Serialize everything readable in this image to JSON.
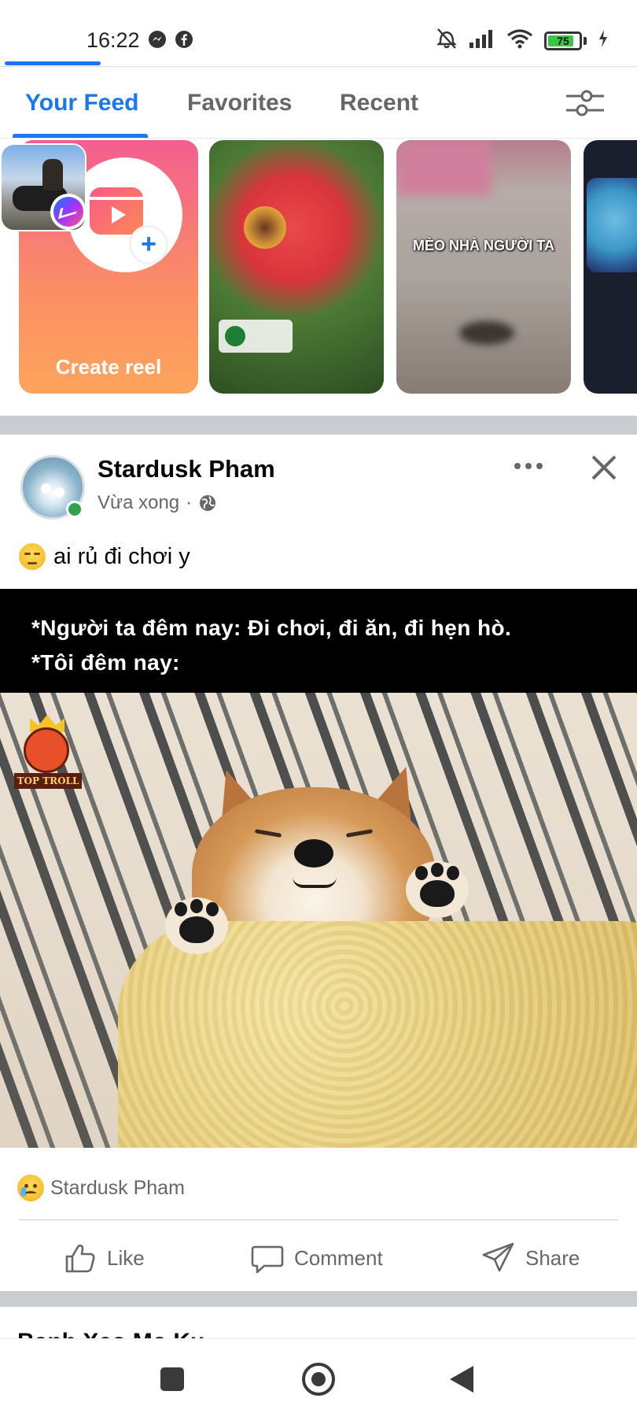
{
  "status_bar": {
    "time": "16:22",
    "left_icons": [
      "messenger-icon",
      "facebook-icon"
    ],
    "right_icons": [
      "mute-icon",
      "signal-icon",
      "wifi-icon",
      "battery-icon",
      "charging-icon"
    ],
    "battery_level": "75"
  },
  "tabs": [
    {
      "label": "Your Feed",
      "active": true
    },
    {
      "label": "Favorites",
      "active": false
    },
    {
      "label": "Recent",
      "active": false
    }
  ],
  "filter_icon": "filter-sliders-icon",
  "reels": {
    "create_label": "Create reel",
    "items": [
      {
        "caption": ""
      },
      {
        "caption": "MÈO NHÀ NGƯỜI TA"
      },
      {
        "caption": ""
      }
    ]
  },
  "post": {
    "author": "Stardusk Pham",
    "time": "Vừa xong",
    "separator": "·",
    "audience_icon": "globe-icon",
    "text": "ai rủ đi chơi y",
    "text_emoji": "pensive-face-emoji",
    "meme_lines": [
      "*Người ta đêm nay: Đi chơi, đi ăn, đi hẹn hò.",
      "*Tôi đêm nay:"
    ],
    "watermark": "TOP TROLL",
    "reaction_by": "Stardusk Pham",
    "reaction_emoji": "sad-face-emoji",
    "actions": {
      "like": "Like",
      "comment": "Comment",
      "share": "Share"
    }
  },
  "next_post": {
    "author_partial": "Banh Xeo Mo Ku",
    "more": "···"
  },
  "colors": {
    "accent": "#1877f2",
    "separator_gray": "#c9ccd1",
    "online_green": "#31a24c",
    "secondary_text": "#65676b"
  }
}
